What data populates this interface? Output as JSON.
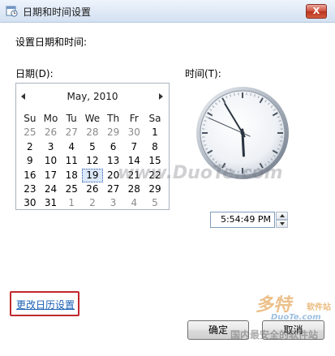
{
  "window": {
    "title": "日期和时间设置",
    "close_label": "X",
    "icon": "calendar-clock-icon"
  },
  "heading": "设置日期和时间:",
  "date_label": "日期(D):",
  "time_label": "时间(T):",
  "calendar": {
    "month_title": "May, 2010",
    "weekdays": [
      "Su",
      "Mo",
      "Tu",
      "We",
      "Th",
      "Fr",
      "Sa"
    ],
    "weeks": [
      [
        "25",
        "26",
        "27",
        "28",
        "29",
        "30",
        "1"
      ],
      [
        "2",
        "3",
        "4",
        "5",
        "6",
        "7",
        "8"
      ],
      [
        "9",
        "10",
        "11",
        "12",
        "13",
        "14",
        "15"
      ],
      [
        "16",
        "17",
        "18",
        "19",
        "20",
        "21",
        "22"
      ],
      [
        "23",
        "24",
        "25",
        "26",
        "27",
        "28",
        "29"
      ],
      [
        "30",
        "31",
        "1",
        "2",
        "3",
        "4",
        "5"
      ]
    ],
    "selected_day": "19"
  },
  "clock": {
    "hours": 5,
    "minutes": 54,
    "seconds": 49
  },
  "time_value": "5:54:49 PM",
  "change_calendar_link": "更改日历设置",
  "buttons": {
    "ok": "确定",
    "cancel": "取消"
  },
  "watermarks": {
    "main": "www.DuoTe.com",
    "logo": "多特",
    "logo_sub": "软件站",
    "url": "DuoTe.com",
    "footer": "国内最安全的软件站"
  },
  "colors": {
    "link": "#1a5fb4",
    "highlight_frame": "#c0282d",
    "selected_day_bg": "#dbe8fa"
  }
}
